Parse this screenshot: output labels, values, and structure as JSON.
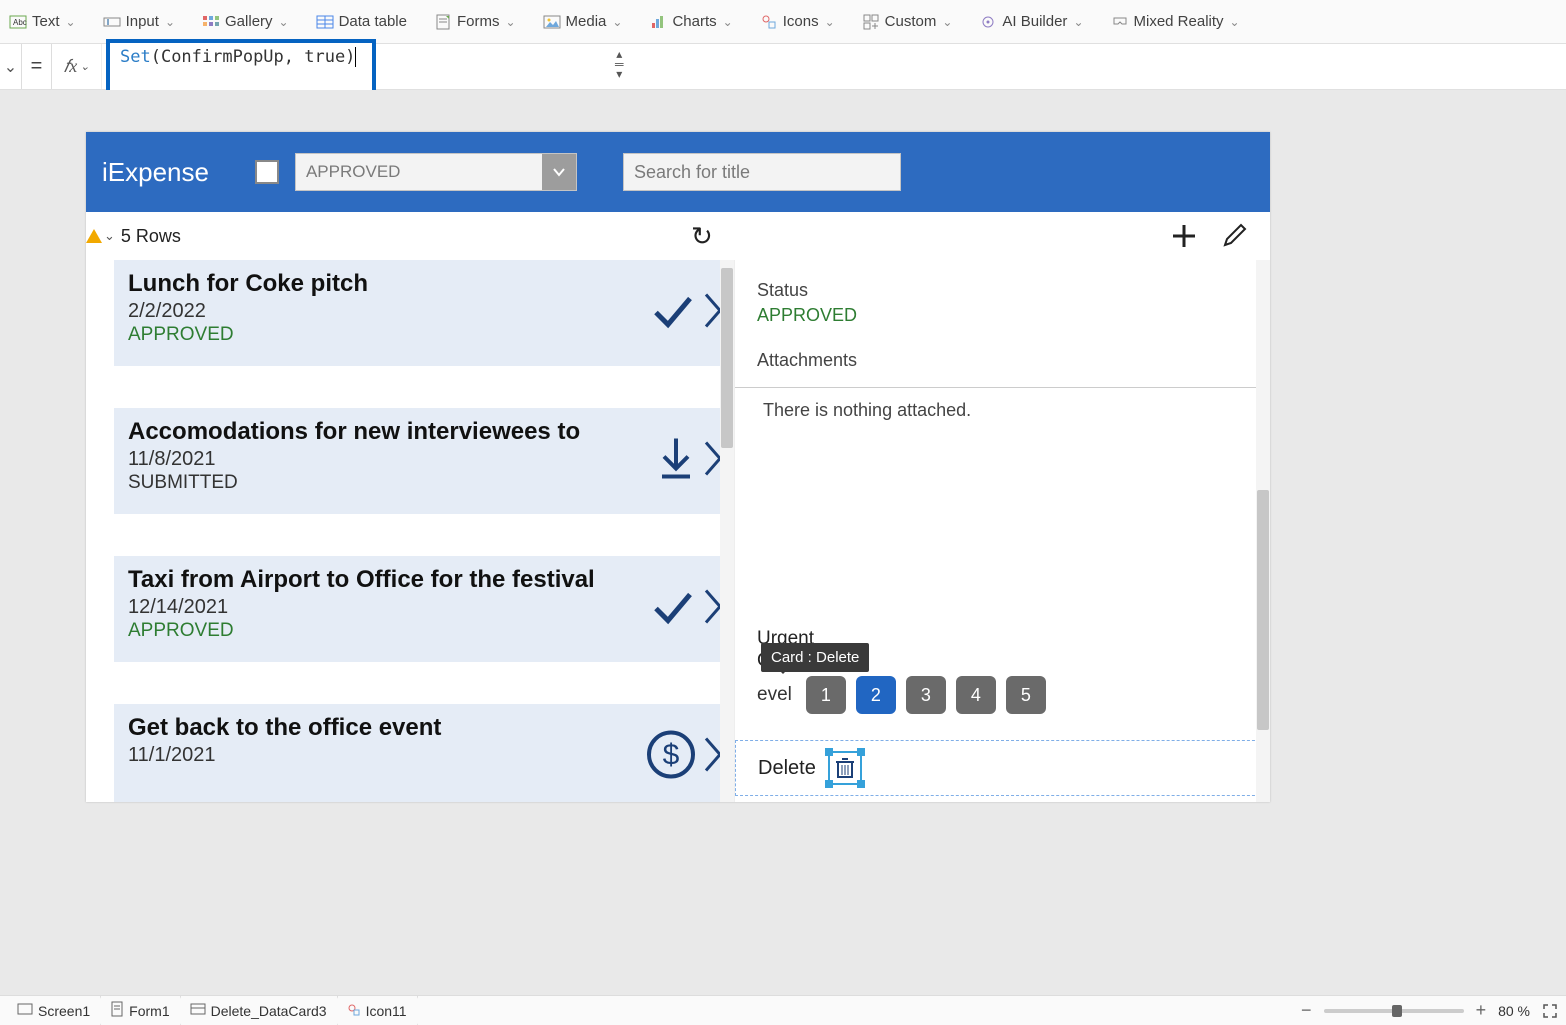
{
  "ribbon": {
    "items": [
      {
        "label": "Text",
        "icon": "text"
      },
      {
        "label": "Input",
        "icon": "input"
      },
      {
        "label": "Gallery",
        "icon": "gallery"
      },
      {
        "label": "Data table",
        "icon": "table"
      },
      {
        "label": "Forms",
        "icon": "form"
      },
      {
        "label": "Media",
        "icon": "media"
      },
      {
        "label": "Charts",
        "icon": "chart"
      },
      {
        "label": "Icons",
        "icon": "icons"
      },
      {
        "label": "Custom",
        "icon": "custom"
      },
      {
        "label": "AI Builder",
        "icon": "ai"
      },
      {
        "label": "Mixed Reality",
        "icon": "mr"
      }
    ]
  },
  "formula": {
    "fn": "Set",
    "args": "(ConfirmPopUp, true)"
  },
  "app": {
    "title": "iExpense",
    "filter_value": "APPROVED",
    "search_placeholder": "Search for title",
    "row_count_label": "5 Rows",
    "items": [
      {
        "title": "Lunch for Coke pitch",
        "date": "2/2/2022",
        "status": "APPROVED",
        "status_class": "approved",
        "icon": "check"
      },
      {
        "title": "Accomodations for new interviewees to",
        "date": "11/8/2021",
        "status": "SUBMITTED",
        "status_class": "submitted",
        "icon": "download"
      },
      {
        "title": "Taxi from Airport to Office for the festival",
        "date": "12/14/2021",
        "status": "APPROVED",
        "status_class": "approved",
        "icon": "check"
      },
      {
        "title": "Get back to the office event",
        "date": "11/1/2021",
        "status": "",
        "status_class": "",
        "icon": "dollar"
      }
    ],
    "detail": {
      "status_label": "Status",
      "status_value": "APPROVED",
      "attachments_label": "Attachments",
      "attachments_empty": "There is nothing attached.",
      "urgent_label": "Urgent",
      "urgent_value": "On",
      "level_label": "evel",
      "levels": [
        "1",
        "2",
        "3",
        "4",
        "5"
      ],
      "level_active": 2,
      "delete_label": "Delete",
      "tooltip": "Card : Delete"
    }
  },
  "breadcrumbs": [
    {
      "label": "Screen1",
      "icon": "screen"
    },
    {
      "label": "Form1",
      "icon": "form"
    },
    {
      "label": "Delete_DataCard3",
      "icon": "card"
    },
    {
      "label": "Icon11",
      "icon": "icon"
    }
  ],
  "zoom": {
    "value": "80",
    "unit": "%"
  }
}
